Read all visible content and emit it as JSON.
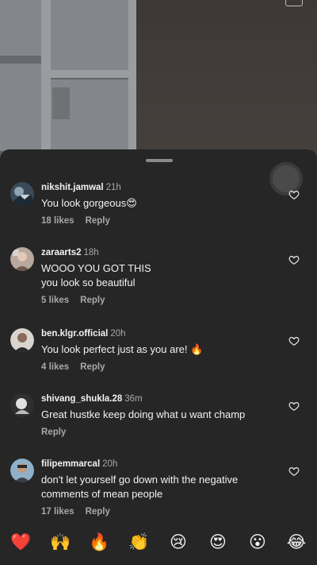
{
  "comments": [
    {
      "username": "nikshit.jamwal",
      "time": "21h",
      "text": "You look gorgeous😍",
      "likes": "18 likes",
      "reply": "Reply"
    },
    {
      "username": "zaraarts2",
      "time": "18h",
      "text": "WOOO YOU GOT THIS\nyou look so beautiful",
      "likes": "5 likes",
      "reply": "Reply"
    },
    {
      "username": "ben.klgr.official",
      "time": "20h",
      "text": "You look perfect just as you are! 🔥",
      "likes": "4 likes",
      "reply": "Reply"
    },
    {
      "username": "shivang_shukla.28",
      "time": "36m",
      "text": "Great hustke keep doing what u want champ",
      "likes": "",
      "reply": "Reply"
    },
    {
      "username": "filipemmarcal",
      "time": "20h",
      "text": "don't let yourself go down with the negative comments of mean people",
      "likes": "17 likes",
      "reply": "Reply"
    }
  ],
  "emoji_bar": [
    "❤️",
    "🙌",
    "🔥",
    "👏",
    "😢",
    "😍",
    "😮",
    "😂"
  ],
  "colors": {
    "sheet": "#262626",
    "muted": "#a8a8a8",
    "text": "#f2f2f2"
  },
  "icons": {
    "like": "heart-outline-icon"
  }
}
